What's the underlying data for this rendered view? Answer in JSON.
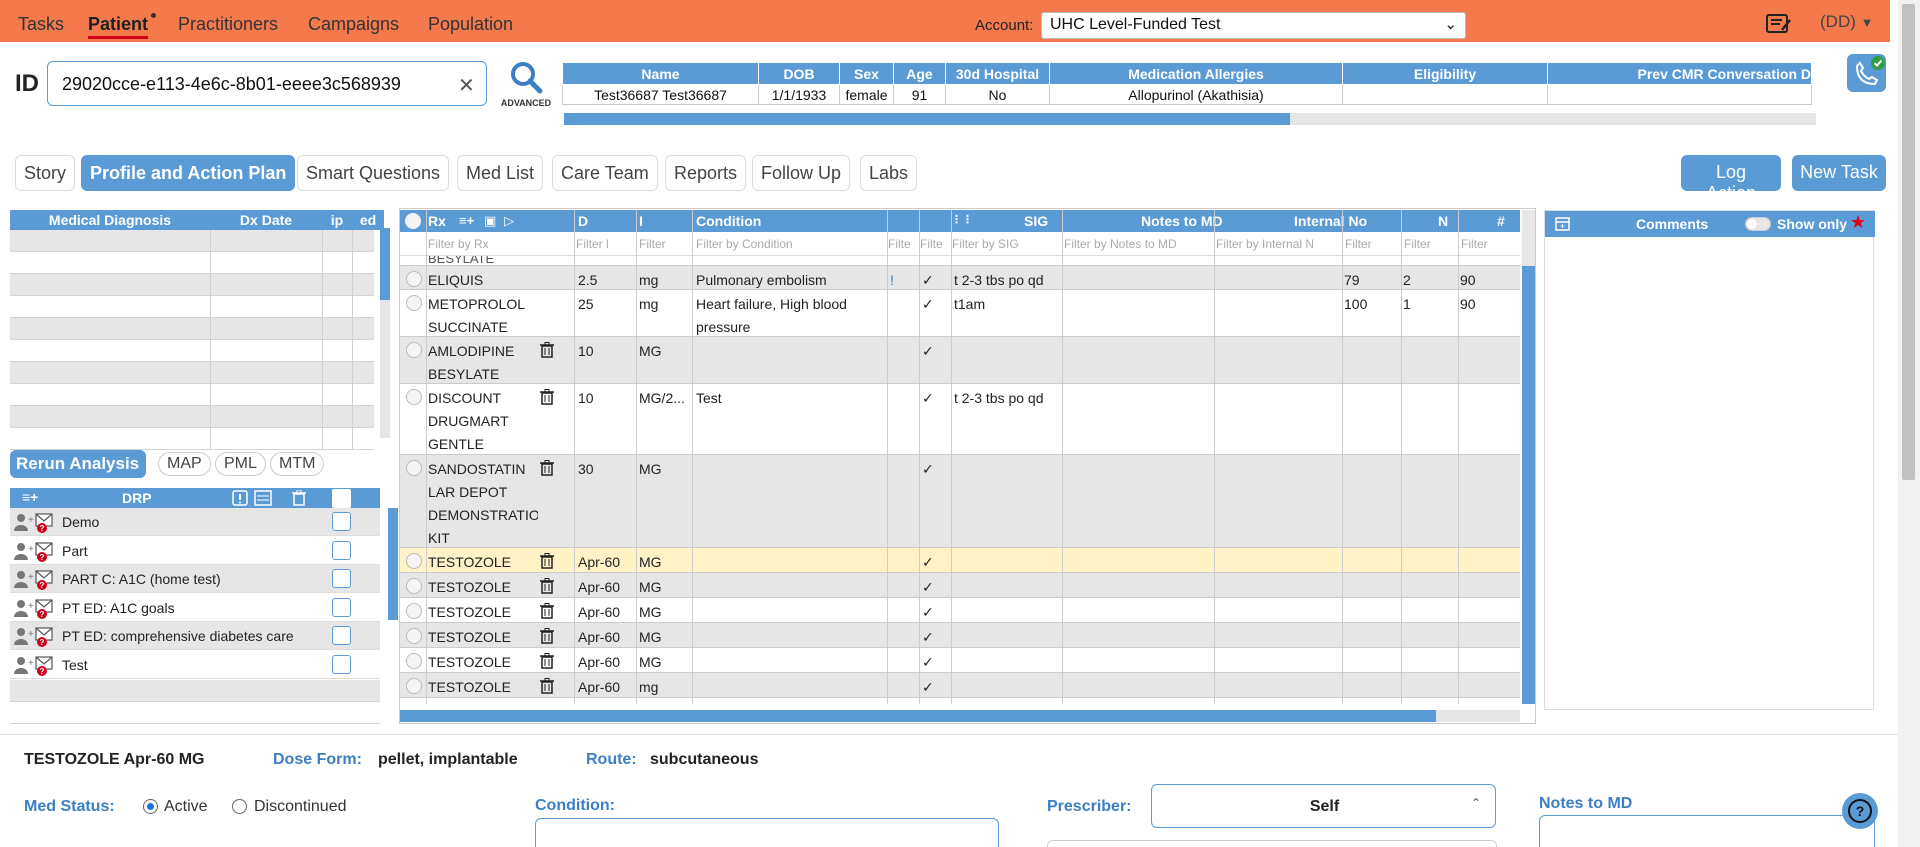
{
  "nav": {
    "tabs": [
      "Tasks",
      "Patient",
      "Practitioners",
      "Campaigns",
      "Population"
    ],
    "account_label": "Account:",
    "account_value": "UHC Level-Funded Test",
    "user_label": "(DD)"
  },
  "id_section": {
    "label": "ID",
    "value": "29020cce-e113-4e6c-8b01-eeee3c568939",
    "search_label": "ADVANCED"
  },
  "patient": {
    "headers": [
      "Name",
      "DOB",
      "Sex",
      "Age",
      "30d Hospital",
      "Medication Allergies",
      "Eligibility",
      "Prev CMR Conversation D"
    ],
    "row": [
      "Test36687 Test36687",
      "1/1/1933",
      "female",
      "91",
      "No",
      "Allopurinol (Akathisia)",
      "",
      ""
    ],
    "scroll_fraction": 0.58
  },
  "tabs": [
    "Story",
    "Profile and Action Plan",
    "Smart Questions",
    "Med List",
    "Care Team",
    "Reports",
    "Follow Up",
    "Labs"
  ],
  "actions": {
    "log_action": "Log Action",
    "new_task": "New Task"
  },
  "diagnosis": {
    "headers": [
      "Medical Diagnosis",
      "Dx Date",
      "ip",
      "ed"
    ]
  },
  "analysis": {
    "rerun": "Rerun Analysis",
    "pills": [
      "MAP",
      "PML",
      "MTM"
    ]
  },
  "drp": {
    "header": "DRP",
    "items": [
      "Demo",
      "Part",
      "PART C: A1C (home test)",
      "PT ED: A1C goals",
      "PT ED: comprehensive diabetes care",
      "Test"
    ]
  },
  "rx": {
    "headers": [
      "Rx",
      "D",
      "I",
      "Condition",
      "",
      "",
      "SIG",
      "Notes to MD",
      "Internal No",
      "N",
      "#",
      "["
    ],
    "filters": [
      "Filter by Rx",
      "Filter l",
      "Filter",
      "Filter by Condition",
      "Filte",
      "Filte",
      "Filter by SIG",
      "Filter by Notes to MD",
      "Filter by Internal N",
      "Filter",
      "Filter",
      "Filter"
    ],
    "partial_top": "BESYLATE",
    "rows": [
      {
        "rx": "ELIQUIS",
        "d": "2.5",
        "u": "mg",
        "cond": "Pulmonary embolism",
        "f1": "!",
        "f2": "✓",
        "sig": "t 2-3 tbs po qd",
        "n1": "79",
        "n2": "2",
        "n3": "90"
      },
      {
        "rx": "METOPROLOL SUCCINATE",
        "d": "25",
        "u": "mg",
        "cond": "Heart failure, High blood pressure",
        "f1": "",
        "f2": "✓",
        "sig": "t1am",
        "n1": "100",
        "n2": "1",
        "n3": "90"
      },
      {
        "rx": "AMLODIPINE BESYLATE",
        "d": "10",
        "u": "MG",
        "cond": "",
        "f1": "",
        "f2": "✓",
        "sig": "",
        "n1": "",
        "n2": "",
        "n3": ""
      },
      {
        "rx": "DISCOUNT DRUGMART GENTLE LAXATIVE",
        "d": "10",
        "u": "MG/2...",
        "cond": "Test",
        "f1": "",
        "f2": "✓",
        "sig": "t 2-3 tbs po qd",
        "n1": "",
        "n2": "",
        "n3": ""
      },
      {
        "rx": "SANDOSTATIN LAR DEPOT DEMONSTRATION KIT",
        "d": "30",
        "u": "MG",
        "cond": "",
        "f1": "",
        "f2": "✓",
        "sig": "",
        "n1": "",
        "n2": "",
        "n3": ""
      },
      {
        "rx": "TESTOZOLE",
        "d": "Apr-60",
        "u": "MG",
        "cond": "",
        "f1": "",
        "f2": "✓",
        "sig": "",
        "n1": "",
        "n2": "",
        "n3": ""
      },
      {
        "rx": "TESTOZOLE",
        "d": "Apr-60",
        "u": "MG",
        "cond": "",
        "f1": "",
        "f2": "✓",
        "sig": "",
        "n1": "",
        "n2": "",
        "n3": ""
      },
      {
        "rx": "TESTOZOLE",
        "d": "Apr-60",
        "u": "MG",
        "cond": "",
        "f1": "",
        "f2": "✓",
        "sig": "",
        "n1": "",
        "n2": "",
        "n3": ""
      },
      {
        "rx": "TESTOZOLE",
        "d": "Apr-60",
        "u": "MG",
        "cond": "",
        "f1": "",
        "f2": "✓",
        "sig": "",
        "n1": "",
        "n2": "",
        "n3": ""
      },
      {
        "rx": "TESTOZOLE",
        "d": "Apr-60",
        "u": "MG",
        "cond": "",
        "f1": "",
        "f2": "✓",
        "sig": "",
        "n1": "",
        "n2": "",
        "n3": ""
      },
      {
        "rx": "TESTOZOLE",
        "d": "Apr-60",
        "u": "mg",
        "cond": "",
        "f1": "",
        "f2": "✓",
        "sig": "",
        "n1": "",
        "n2": "",
        "n3": ""
      }
    ]
  },
  "comments": {
    "header": "Comments",
    "show_only": "Show only"
  },
  "detail": {
    "title": "TESTOZOLE Apr-60 MG",
    "dose_form_label": "Dose Form:",
    "dose_form_value": "pellet, implantable",
    "route_label": "Route:",
    "route_value": "subcutaneous",
    "med_status_label": "Med Status:",
    "status_active": "Active",
    "status_discontinued": "Discontinued",
    "condition_label": "Condition:",
    "prescriber_label": "Prescriber:",
    "prescriber_value": "Self",
    "notes_label": "Notes to MD"
  },
  "colors": {
    "nav": "#f47a4d",
    "accent": "#5b9bd5",
    "selected_row": "#fff2c7"
  }
}
